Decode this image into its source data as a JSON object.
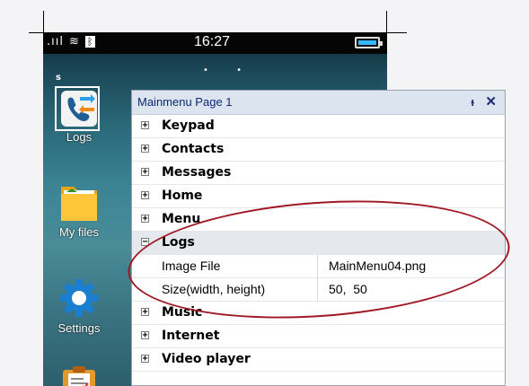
{
  "status_bar": {
    "signal": ".ııl",
    "wifi": "≋",
    "bluetooth": "ᛒ",
    "time": "16:27"
  },
  "home": {
    "page_dots": "• •",
    "section_letter": "s",
    "apps": [
      {
        "label": "Logs",
        "icon": "logs-phone-arrows-icon"
      },
      {
        "label": "My files",
        "icon": "folder-icon"
      },
      {
        "label": "Settings",
        "icon": "gear-icon"
      },
      {
        "label": "",
        "icon": "clipboard-icon"
      }
    ]
  },
  "panel": {
    "title": "Mainmenu Page 1",
    "pin_icon": "ᵼ",
    "close_icon": "✕",
    "items": [
      {
        "toggle": "+",
        "name": "Keypad"
      },
      {
        "toggle": "+",
        "name": "Contacts"
      },
      {
        "toggle": "+",
        "name": "Messages"
      },
      {
        "toggle": "+",
        "name": "Home"
      },
      {
        "toggle": "+",
        "name": "Menu"
      }
    ],
    "logs": {
      "toggle": "−",
      "name": "Logs"
    },
    "logs_props": [
      {
        "name": "Image File",
        "value": "MainMenu04.png"
      },
      {
        "name": "Size(width, height)",
        "value": "50,  50"
      }
    ],
    "items_after": [
      {
        "toggle": "+",
        "name": "Music"
      },
      {
        "toggle": "+",
        "name": "Internet"
      },
      {
        "toggle": "+",
        "name": "Video player"
      }
    ]
  },
  "colors": {
    "annotation_ellipse": "#a01823",
    "panel_header": "#dbe4ef",
    "title_text": "#0c2a70"
  }
}
